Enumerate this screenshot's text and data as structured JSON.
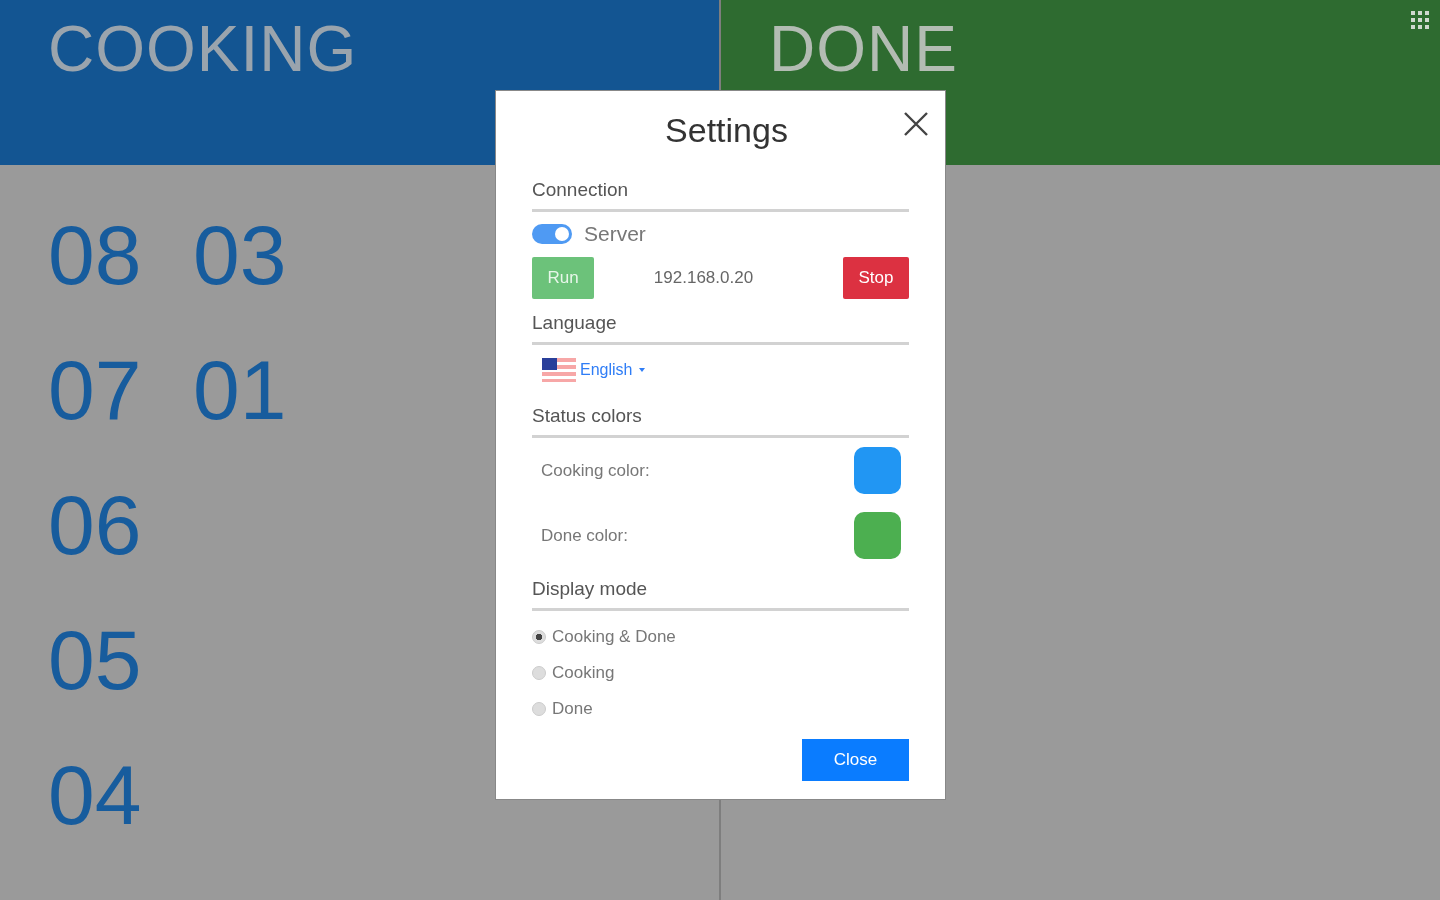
{
  "columns": [
    {
      "title": "COOKING",
      "kind": "cooking",
      "orders": [
        "08",
        "03",
        "07",
        "01",
        "06",
        "05",
        "04"
      ]
    },
    {
      "title": "DONE",
      "kind": "done"
    }
  ],
  "dialog": {
    "title": "Settings",
    "sections": [
      {
        "kind": "connection",
        "heading": "Connection",
        "toggle": {
          "label": "Server",
          "on": true
        },
        "run": "Run",
        "address": "192.168.0.20",
        "stop": "Stop"
      },
      {
        "kind": "language",
        "heading": "Language",
        "value": "English"
      },
      {
        "kind": "colors",
        "heading": "Status colors",
        "items": [
          {
            "label": "Cooking color:",
            "color": "#2196f3"
          },
          {
            "label": "Done color:",
            "color": "#4caf50"
          }
        ]
      },
      {
        "kind": "mode",
        "heading": "Display mode",
        "options": [
          {
            "label": "Cooking & Done",
            "selected": true
          },
          {
            "label": "Cooking",
            "selected": false
          },
          {
            "label": "Done",
            "selected": false
          }
        ]
      }
    ],
    "close": "Close"
  }
}
